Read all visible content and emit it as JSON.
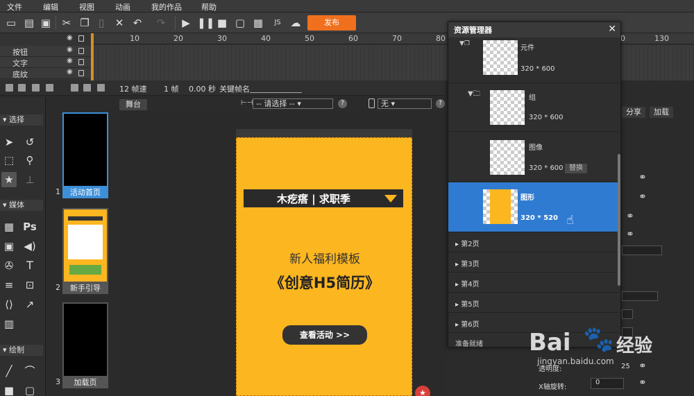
{
  "menu": [
    "文件",
    "编辑",
    "视图",
    "动画",
    "我的作品",
    "帮助"
  ],
  "toolbar": {
    "publish_label": "发布"
  },
  "timeline": {
    "ruler_ticks": [
      "10",
      "20",
      "30",
      "40",
      "50",
      "60",
      "70",
      "80",
      "90",
      "100",
      "110",
      "120",
      "130"
    ],
    "layers": [
      "按钮",
      "文字",
      "底纹"
    ]
  },
  "timeline_controls": {
    "fps": "12 帧速",
    "frame": "1 帧",
    "time": "0.00 秒",
    "keyframe_label": "关键帧名"
  },
  "tools": {
    "section_select": "选择",
    "section_media": "媒体",
    "section_draw": "绘制",
    "ps_label": "Ps",
    "text_tool_label": "T"
  },
  "pages": [
    {
      "num": "1",
      "label": "活动首页"
    },
    {
      "num": "2",
      "label": "新手引导"
    },
    {
      "num": "3",
      "label": "加载页"
    }
  ],
  "stage": {
    "tab": "舞台",
    "select_placeholder": "-- 请选择 --",
    "device_select": "无",
    "help": "?",
    "banner_text": "木疙瘩 | 求职季",
    "subtitle": "新人福利模板",
    "title": "《创意H5简历》",
    "cta": "查看活动 >>",
    "badge": "★"
  },
  "resource_manager": {
    "title": "资源管理器",
    "items": [
      {
        "name": "元件",
        "size": "320 * 600"
      },
      {
        "name": "组",
        "size": "320 * 600"
      },
      {
        "name": "图像",
        "size": "320 * 600",
        "action": "替换"
      },
      {
        "name": "图形",
        "size": "320 * 520"
      }
    ],
    "page_groups": [
      "第2页",
      "第3页",
      "第4页",
      "第5页",
      "第6页"
    ],
    "status": "准备就绪"
  },
  "properties": {
    "tabs": [
      "分享",
      "加载"
    ],
    "field_transparency_label": "透明度:",
    "field_transparency_value": "25",
    "field_xrot_label": "X轴旋转:",
    "field_xrot_value": "0"
  },
  "watermark": {
    "brand_left": "Bai",
    "brand_right": "经验",
    "url": "jingyan.baidu.com"
  },
  "colors": {
    "accent": "#f0701e",
    "selection": "#2f7bd1",
    "canvas": "#fcb620"
  }
}
